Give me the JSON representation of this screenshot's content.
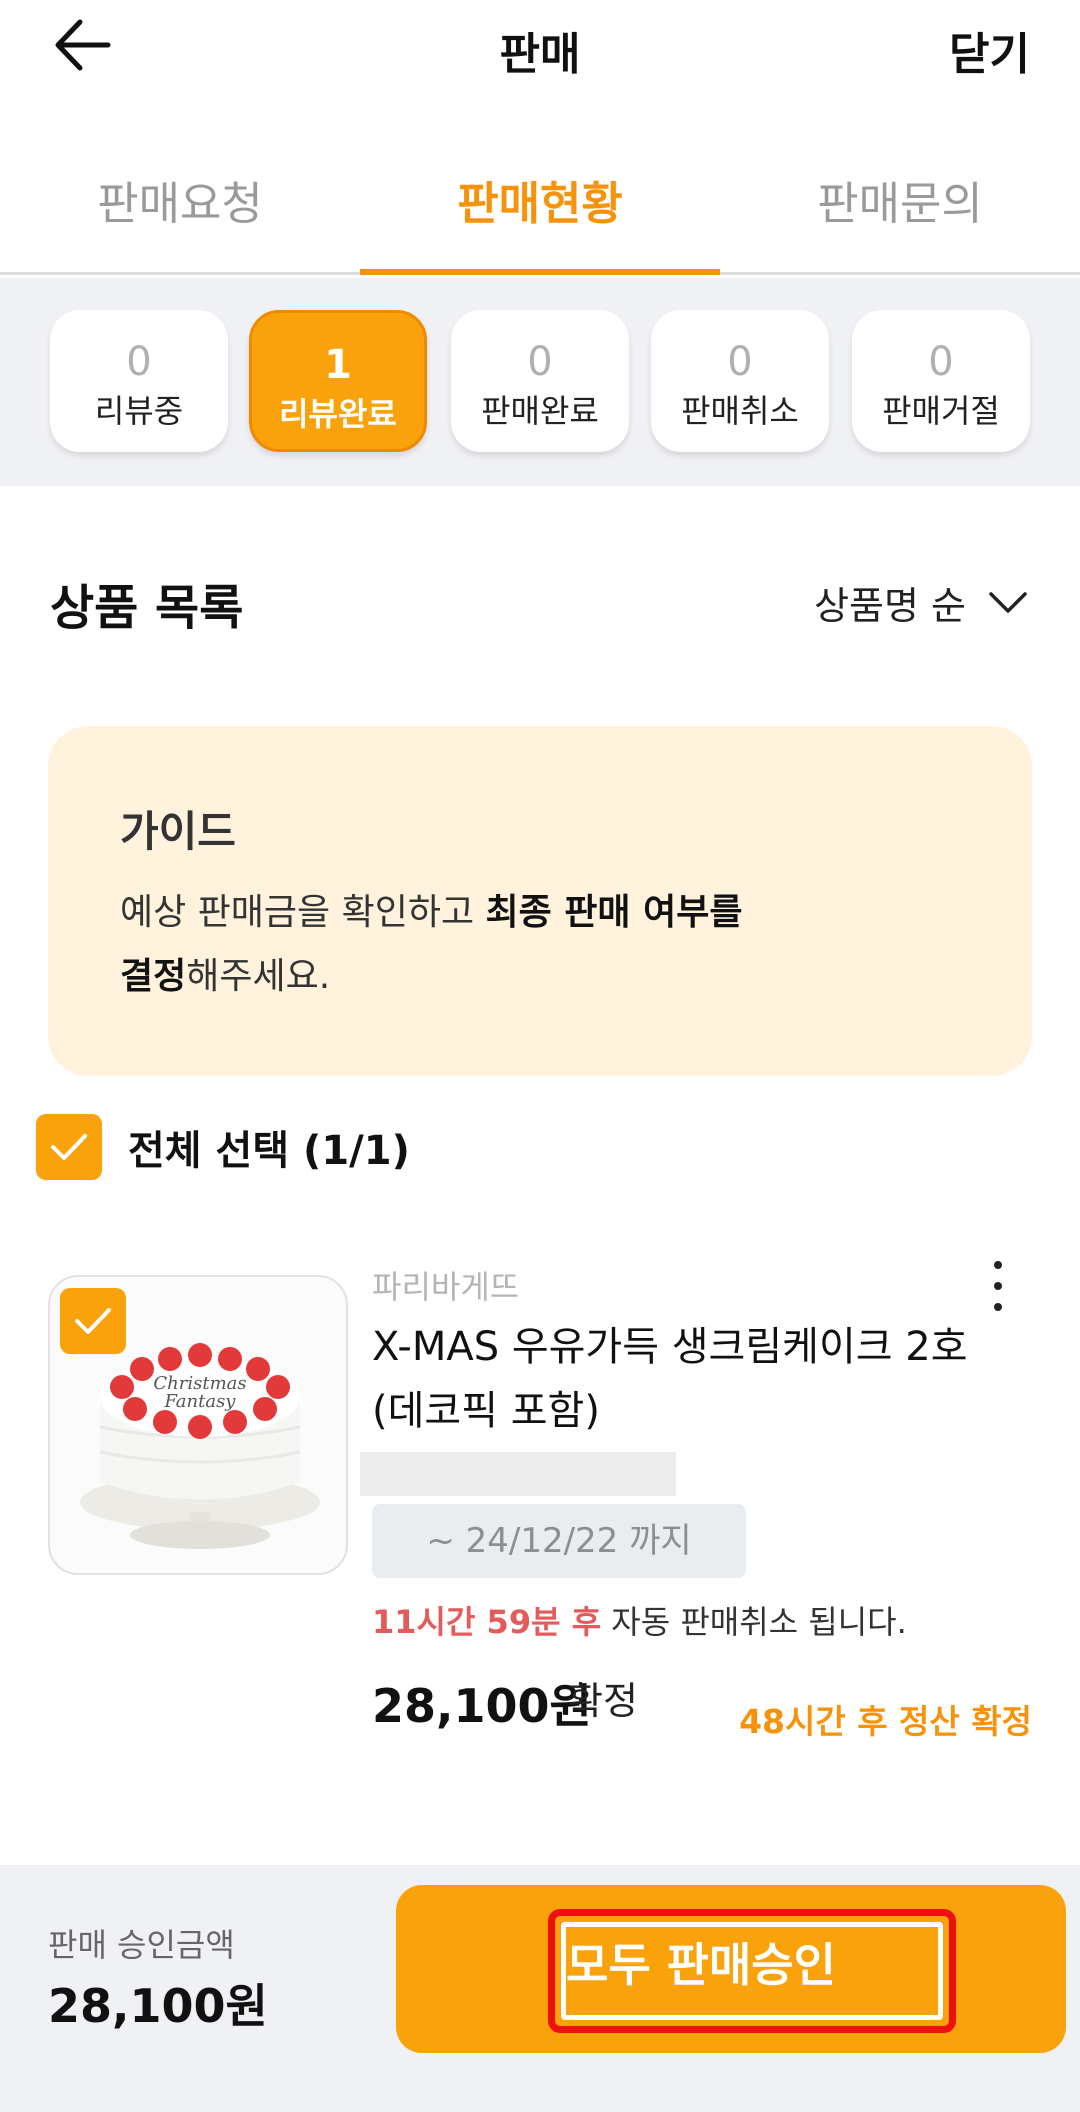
{
  "header": {
    "title": "판매",
    "close_label": "닫기"
  },
  "tabs": [
    {
      "label": "판매요청",
      "active": false
    },
    {
      "label": "판매현황",
      "active": true
    },
    {
      "label": "판매문의",
      "active": false
    }
  ],
  "status_chips": [
    {
      "count": "0",
      "label": "리뷰중",
      "active": false
    },
    {
      "count": "1",
      "label": "리뷰완료",
      "active": true
    },
    {
      "count": "0",
      "label": "판매완료",
      "active": false
    },
    {
      "count": "0",
      "label": "판매취소",
      "active": false
    },
    {
      "count": "0",
      "label": "판매거절",
      "active": false
    }
  ],
  "list": {
    "title": "상품 목록",
    "sort_label": "상품명 순"
  },
  "guide": {
    "title": "가이드",
    "text_1": "예상 판매금을 확인하고 ",
    "text_bold_1": "최종 판매 여부를",
    "text_bold_2": "결정",
    "text_2": "해주세요."
  },
  "select_all": {
    "label": "전체 선택 (1/1)",
    "checked": true
  },
  "product": {
    "brand": "파리바게뜨",
    "name": "X-MAS 우유가득 생크림케이크 2호 (데코픽 포함)",
    "cake_topper_text_1": "Christmas",
    "cake_topper_text_2": "Fantasy",
    "deadline": "~ 24/12/22 까지",
    "cancel_time": "11시간 59분 후",
    "cancel_text": " 자동 판매취소 됩니다.",
    "price": "28,100원",
    "price_suffix": "확정",
    "settlement": "48시간 후 정산 확정",
    "checked": true
  },
  "footer": {
    "total_label": "판매 승인금액",
    "total_value": "28,100원",
    "approve_label": "모두 판매승인"
  },
  "colors": {
    "accent": "#f9a20c",
    "accent_text": "#f7930a",
    "warning": "#e45b5b",
    "highlight_outline": "#ee1111"
  }
}
